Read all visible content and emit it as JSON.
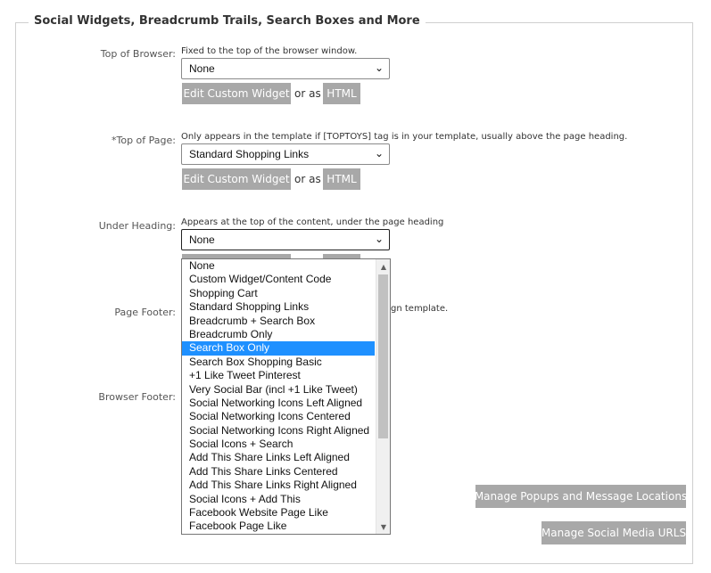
{
  "section": {
    "title": "Social Widgets, Breadcrumb Trails, Search Boxes and More"
  },
  "rows": {
    "top_of_browser": {
      "label": "Top of Browser:",
      "hint": "Fixed to the top of the browser window.",
      "selected": "None",
      "edit_label": "Edit Custom Widget",
      "or_as": "or as",
      "html_label": "HTML"
    },
    "top_of_page": {
      "label": "*Top of Page:",
      "hint": "Only appears in the template if [TOPTOYS] tag is in your template, usually above the page heading.",
      "selected": "Standard Shopping Links",
      "edit_label": "Edit Custom Widget",
      "or_as": "or as",
      "html_label": "HTML"
    },
    "under_heading": {
      "label": "Under Heading:",
      "hint": "Appears at the top of the content, under the page heading",
      "selected": "None"
    },
    "page_footer": {
      "label": "Page Footer:",
      "hint_tail": "gn template."
    },
    "browser_footer": {
      "label": "Browser Footer:"
    }
  },
  "dropdown": {
    "options": [
      "None",
      "Custom Widget/Content Code",
      "Shopping Cart",
      "Standard Shopping Links",
      "Breadcrumb + Search Box",
      "Breadcrumb Only",
      "Search Box Only",
      "Search Box Shopping Basic",
      "+1 Like Tweet Pinterest",
      "Very Social Bar (incl +1 Like Tweet)",
      "Social Networking Icons Left Aligned",
      "Social Networking Icons Centered",
      "Social Networking Icons Right Aligned",
      "Social Icons + Search",
      "Add This Share Links Left Aligned",
      "Add This Share Links Centered",
      "Add This Share Links Right Aligned",
      "Social Icons + Add This",
      "Facebook Website Page Like",
      "Facebook Page Like"
    ],
    "highlighted": "Search Box Only"
  },
  "actions": {
    "manage_popups": "Manage Popups and Message Locations",
    "manage_social": "Manage Social Media URLS"
  }
}
